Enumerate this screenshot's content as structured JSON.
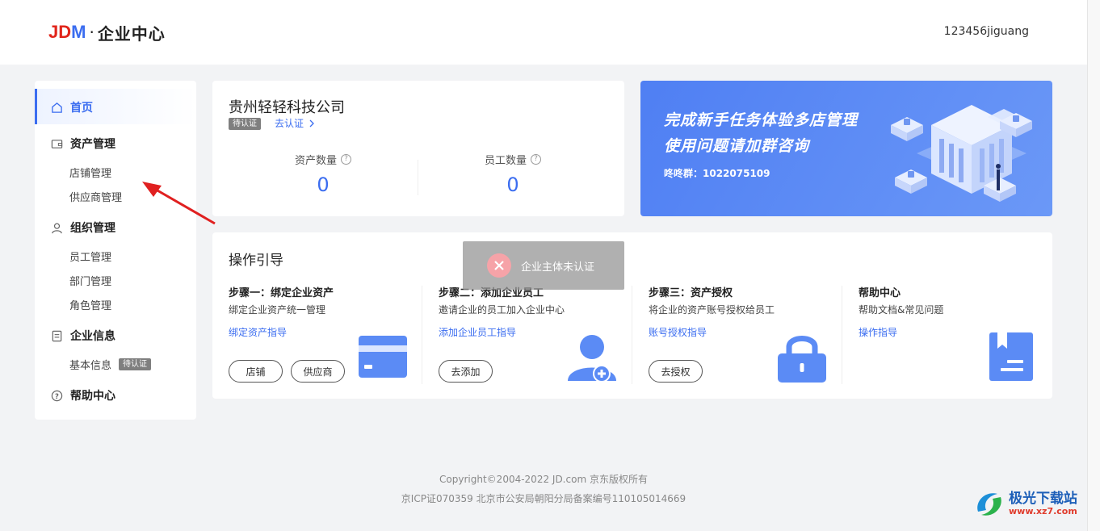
{
  "header": {
    "logo_jd": "JD",
    "logo_m": "M",
    "logo_dot": "·",
    "logo_text": "企业中心",
    "username": "123456jiguang"
  },
  "sidebar": {
    "home": "首页",
    "asset_management": "资产管理",
    "store_management": "店铺管理",
    "supplier_management": "供应商管理",
    "org_management": "组织管理",
    "employee_management": "员工管理",
    "department_management": "部门管理",
    "role_management": "角色管理",
    "enterprise_info": "企业信息",
    "basic_info": "基本信息",
    "basic_info_badge": "待认证",
    "help_center": "帮助中心"
  },
  "company": {
    "name": "贵州轻轻科技公司",
    "status_badge": "待认证",
    "verify_link": "去认证",
    "asset_count_label": "资产数量",
    "asset_count": "0",
    "employee_count_label": "员工数量",
    "employee_count": "0",
    "help_glyph": "?"
  },
  "banner": {
    "line1": "完成新手任务体验多店管理",
    "line2": "使用问题请加群咨询",
    "group": "咚咚群：1022075109"
  },
  "guide": {
    "title": "操作引导",
    "steps": [
      {
        "title": "步骤一：绑定企业资产",
        "desc": "绑定企业资产统一管理",
        "link": "绑定资产指导",
        "buttons": [
          "店铺",
          "供应商"
        ]
      },
      {
        "title": "步骤二：添加企业员工",
        "desc": "邀请企业的员工加入企业中心",
        "link": "添加企业员工指导",
        "buttons": [
          "去添加"
        ]
      },
      {
        "title": "步骤三：资产授权",
        "desc": "将企业的资产账号授权给员工",
        "link": "账号授权指导",
        "buttons": [
          "去授权"
        ]
      },
      {
        "title": "帮助中心",
        "desc": "帮助文档&常见问题",
        "link": "操作指导",
        "buttons": []
      }
    ]
  },
  "toast": {
    "text": "企业主体未认证"
  },
  "footer": {
    "copyright": "Copyright©2004-2022 JD.com 京东版权所有",
    "icp": "京ICP证070359 北京市公安局朝阳分局备案编号110105014669"
  },
  "watermark": {
    "name": "极光下载站",
    "url": "www.xz7.com"
  },
  "colors": {
    "brand_red": "#e1251b",
    "accent_blue": "#3b6df0",
    "banner_blue": "#5b8bf5",
    "annotation_arrow": "#e02020"
  }
}
